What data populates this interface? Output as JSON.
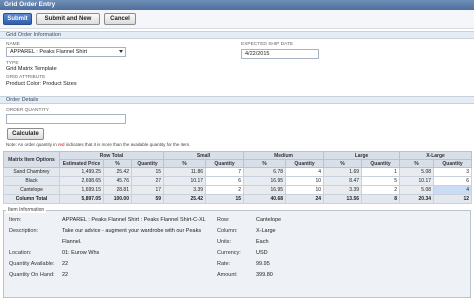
{
  "window": {
    "title": "Grid Order Entry"
  },
  "toolbar": {
    "submit": "Submit",
    "submit_new": "Submit and New",
    "cancel": "Cancel"
  },
  "grid_order_info": {
    "section_title": "Grid Order Information",
    "name_label": "NAME",
    "name_value": "APPAREL : Peaks Flannel Shirt",
    "type_label": "TYPE",
    "type_value": "Grid Matrix Template",
    "attr_label": "GRID ATTRIBUTE",
    "attr_value": "Product Color: Product Sizes",
    "ship_label": "EXPECTED SHIP DATE",
    "ship_value": "4/22/2015"
  },
  "order_details": {
    "section_title": "Order Details",
    "qty_label": "ORDER QUANTITY",
    "qty_value": "",
    "calculate": "Calculate",
    "note_pre": "Note: An order quantity in",
    "note_red": "red",
    "note_post": "indicates that it is more than the available quantity for the item."
  },
  "grid": {
    "groups": [
      "Matrix Item Options",
      "Row Total",
      "Small",
      "Medium",
      "Large",
      "X-Large"
    ],
    "sub": {
      "price": "Estimated Price",
      "pct": "%",
      "qty": "Quantity"
    },
    "rows": [
      {
        "name": "Sand Chambrey",
        "price": "1,499.25",
        "pct": "25.42",
        "qty": "15",
        "s_pct": "11.86",
        "s_qty": "7",
        "m_pct": "6.78",
        "m_qty": "4",
        "l_pct": "1.69",
        "l_qty": "1",
        "xl_pct": "5.08",
        "xl_qty": "3"
      },
      {
        "name": "Black",
        "price": "2,698.65",
        "pct": "45.76",
        "qty": "27",
        "s_pct": "10.17",
        "s_qty": "6",
        "m_pct": "16.95",
        "m_qty": "10",
        "l_pct": "8.47",
        "l_qty": "5",
        "xl_pct": "10.17",
        "xl_qty": "6"
      },
      {
        "name": "Cantelope",
        "price": "1,699.15",
        "pct": "28.81",
        "qty": "17",
        "s_pct": "3.39",
        "s_qty": "2",
        "m_pct": "16.95",
        "m_qty": "10",
        "l_pct": "3.39",
        "l_qty": "2",
        "xl_pct": "5.08",
        "xl_qty": "4"
      }
    ],
    "total": {
      "name": "Column Total",
      "price": "5,897.05",
      "pct": "100.00",
      "qty": "59",
      "s_pct": "25.42",
      "s_qty": "15",
      "m_pct": "40.68",
      "m_qty": "24",
      "l_pct": "13.56",
      "l_qty": "8",
      "xl_pct": "20.34",
      "xl_qty": "12"
    }
  },
  "item_info": {
    "title": "Item Information",
    "item_k": "Item:",
    "item_v": "APPAREL : Peaks Flannel Shirt : Peaks Flannel Shirt-C-XL",
    "desc_k": "Description:",
    "desc_v1": "Take our advice - augment your wardrobe with our Peaks",
    "desc_v2": "Flannel.",
    "loc_k": "Location:",
    "loc_v": "01: Eurow Whs",
    "qa_k": "Quantity Available:",
    "qa_v": "22",
    "qoh_k": "Quantity On Hand:",
    "qoh_v": "22",
    "row_k": "Row:",
    "row_v": "Cantelope",
    "col_k": "Column:",
    "col_v": "X-Large",
    "units_k": "Units:",
    "units_v": "Each",
    "cur_k": "Currency:",
    "cur_v": "USD",
    "rate_k": "Rate:",
    "rate_v": "99.95",
    "amt_k": "Amount:",
    "amt_v": "399.80"
  }
}
